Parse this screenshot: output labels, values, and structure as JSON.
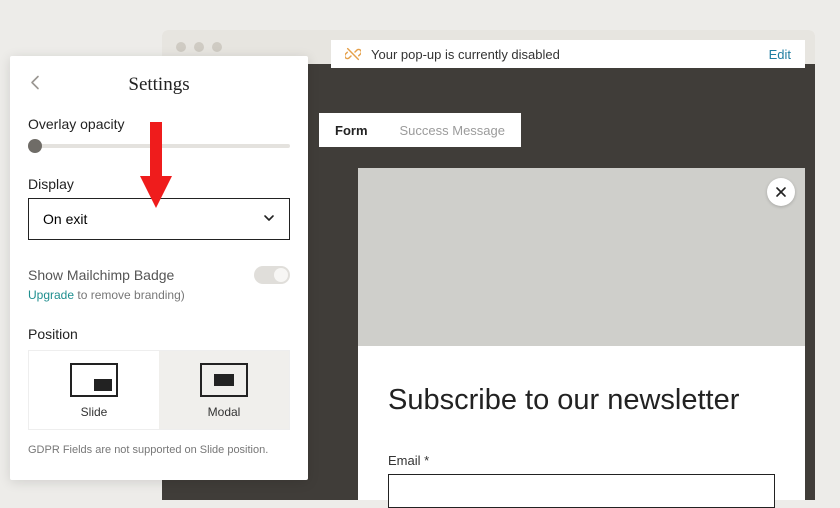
{
  "notice": {
    "text": "Your pop-up is currently disabled",
    "edit": "Edit"
  },
  "tabs": {
    "form": "Form",
    "success": "Success Message"
  },
  "popup": {
    "heading": "Subscribe to our newsletter",
    "email_label": "Email *"
  },
  "settings": {
    "title": "Settings",
    "overlay_label": "Overlay opacity",
    "display_label": "Display",
    "display_value": "On exit",
    "badge_label": "Show Mailchimp Badge",
    "upgrade": "Upgrade",
    "upgrade_rest": " to remove branding)",
    "position_label": "Position",
    "slide_label": "Slide",
    "modal_label": "Modal",
    "gdpr_note": "GDPR Fields are not supported on Slide position."
  }
}
